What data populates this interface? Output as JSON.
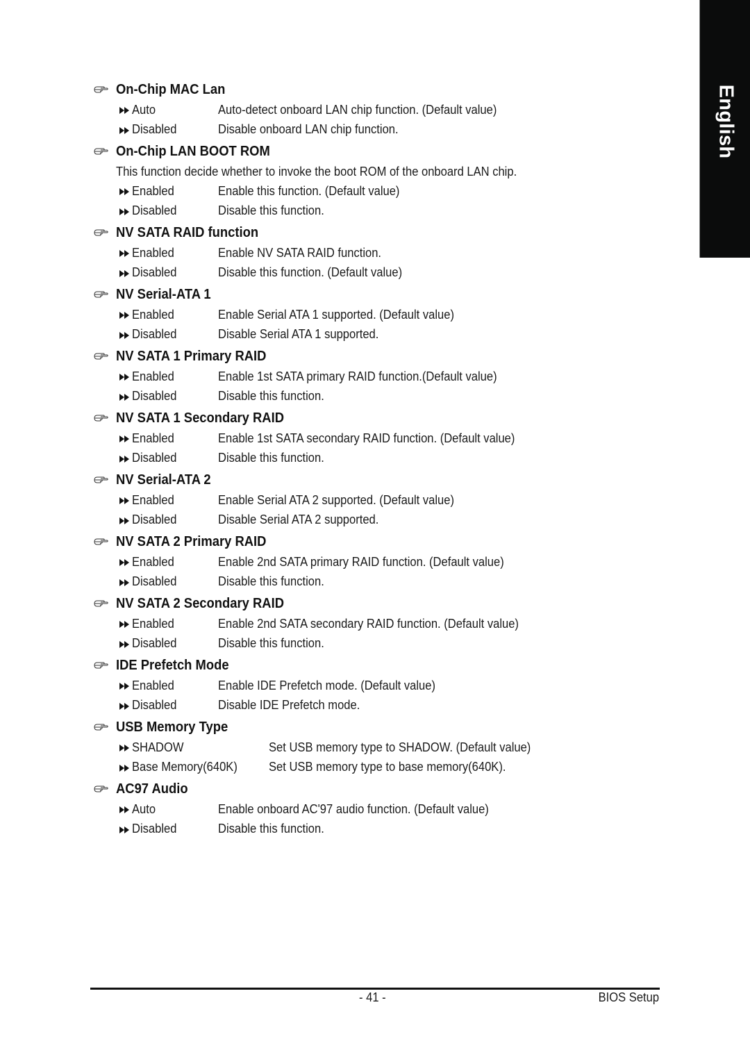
{
  "language_tab": "English",
  "sections": [
    {
      "title": "On-Chip MAC Lan",
      "options": [
        {
          "name": "Auto",
          "text": "Auto-detect onboard LAN chip function. (Default value)"
        },
        {
          "name": "Disabled",
          "text": "Disable onboard LAN chip function."
        }
      ]
    },
    {
      "title": "On-Chip LAN BOOT ROM",
      "description": "This function decide whether to invoke the boot ROM of the onboard LAN chip.",
      "options": [
        {
          "name": "Enabled",
          "text": "Enable this function. (Default value)"
        },
        {
          "name": "Disabled",
          "text": "Disable this function."
        }
      ]
    },
    {
      "title": "NV SATA RAID function",
      "options": [
        {
          "name": "Enabled",
          "text": "Enable NV SATA RAID function."
        },
        {
          "name": "Disabled",
          "text": "Disable this function. (Default value)"
        }
      ]
    },
    {
      "title": "NV Serial-ATA 1",
      "options": [
        {
          "name": "Enabled",
          "text": "Enable Serial ATA 1 supported. (Default value)"
        },
        {
          "name": "Disabled",
          "text": "Disable Serial ATA 1 supported."
        }
      ]
    },
    {
      "title": "NV SATA 1 Primary RAID",
      "options": [
        {
          "name": "Enabled",
          "text": "Enable 1st SATA primary RAID function.(Default value)"
        },
        {
          "name": "Disabled",
          "text": "Disable this function."
        }
      ]
    },
    {
      "title": "NV SATA 1 Secondary RAID",
      "options": [
        {
          "name": "Enabled",
          "text": "Enable 1st SATA secondary RAID function. (Default value)"
        },
        {
          "name": "Disabled",
          "text": "Disable this function."
        }
      ]
    },
    {
      "title": "NV Serial-ATA 2",
      "options": [
        {
          "name": "Enabled",
          "text": "Enable Serial ATA 2 supported. (Default value)"
        },
        {
          "name": "Disabled",
          "text": "Disable Serial ATA 2 supported."
        }
      ]
    },
    {
      "title": "NV SATA 2 Primary RAID",
      "options": [
        {
          "name": "Enabled",
          "text": "Enable 2nd SATA primary RAID function.  (Default value)"
        },
        {
          "name": "Disabled",
          "text": "Disable this function."
        }
      ]
    },
    {
      "title": "NV SATA 2 Secondary RAID",
      "options": [
        {
          "name": "Enabled",
          "text": "Enable 2nd SATA secondary RAID function. (Default value)"
        },
        {
          "name": "Disabled",
          "text": "Disable this function."
        }
      ]
    },
    {
      "title": "IDE Prefetch Mode",
      "options": [
        {
          "name": "Enabled",
          "text": "Enable IDE Prefetch mode. (Default value)"
        },
        {
          "name": "Disabled",
          "text": "Disable IDE Prefetch mode."
        }
      ]
    },
    {
      "title": "USB Memory Type",
      "wide": true,
      "options": [
        {
          "name": "SHADOW",
          "text": "Set USB memory type to SHADOW. (Default value)"
        },
        {
          "name": "Base Memory(640K)",
          "text": "Set USB memory type to base memory(640K)."
        }
      ]
    },
    {
      "title": "AC97 Audio",
      "options": [
        {
          "name": "Auto",
          "text": "Enable onboard AC'97 audio function. (Default value)"
        },
        {
          "name": "Disabled",
          "text": "Disable this function."
        }
      ]
    }
  ],
  "footer": {
    "page_number": "- 41 -",
    "label": "BIOS Setup"
  },
  "icons": {
    "section_marker": "pointing-hand-icon",
    "option_marker": "double-arrow-icon"
  }
}
